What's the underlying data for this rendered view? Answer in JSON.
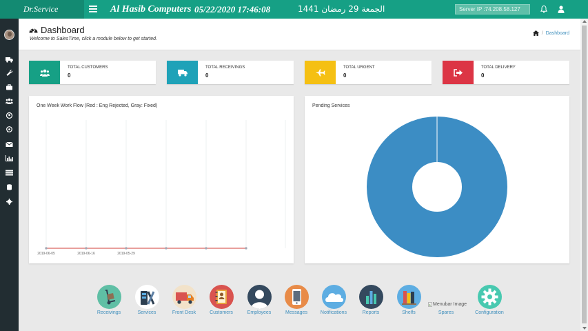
{
  "topbar": {
    "brand": "Dr.Service",
    "company": "Al Hasib Computers",
    "datetime": "05/22/2020 17:46:08",
    "hijri": "الجمعة 29 رمضان 1441",
    "server": "Server IP :74.208.58.127",
    "color": "#16a085"
  },
  "sidebar": {
    "icons": [
      "truck-icon",
      "wrench-icon",
      "briefcase-icon",
      "users-icon",
      "user-circle-icon",
      "whatsapp-icon",
      "envelope-icon",
      "bar-chart-icon",
      "list-icon",
      "database-icon",
      "gear-icon"
    ]
  },
  "header": {
    "title": "Dashboard",
    "subtitle": "Welcome to SalesTime, click a module below to get started.",
    "breadcrumb": "Dashboard"
  },
  "info_boxes": [
    {
      "label": "TOTAL CUSTOMERS",
      "value": "0",
      "color": "#16a085",
      "icon": "users-icon"
    },
    {
      "label": "TOTAL RECEIVINGS",
      "value": "0",
      "color": "#1fa2b8",
      "icon": "truck-icon"
    },
    {
      "label": "TOTAL URGENT",
      "value": "0",
      "color": "#f5c013",
      "icon": "plane-icon"
    },
    {
      "label": "TOTAL DELIVERY",
      "value": "0",
      "color": "#dc3545",
      "icon": "sign-out-icon"
    }
  ],
  "workflow_panel": {
    "title": "One Week Work Flow (Red : Eng Rejected, Gray: Fixed)"
  },
  "pending_panel": {
    "title": "Pending Services"
  },
  "chart_data": [
    {
      "type": "line",
      "title": "One Week Work Flow (Red : Eng Rejected, Gray: Fixed)",
      "x_tick_labels": [
        "2019-06-05",
        "2019-06-16",
        "2019-05-29"
      ],
      "series": [
        {
          "name": "Eng Rejected",
          "color": "#e8736b",
          "values": [
            0,
            0,
            0,
            0,
            0,
            0
          ]
        },
        {
          "name": "Fixed",
          "color": "#a0a8b4",
          "values": [
            0,
            0,
            0,
            0,
            0,
            0
          ]
        }
      ],
      "grid": true
    },
    {
      "type": "pie",
      "subtype": "doughnut",
      "title": "Pending Services",
      "values": [
        100
      ],
      "colors": [
        "#3c8dc4"
      ]
    }
  ],
  "modules": [
    {
      "label": "Receivings",
      "icon": "hand-truck-icon",
      "color": "#5fbfa5"
    },
    {
      "label": "Services",
      "icon": "tools-icon",
      "color": "#ffffff"
    },
    {
      "label": "Front Desk",
      "icon": "delivery-truck-icon",
      "color": "#f2e2c9"
    },
    {
      "label": "Customers",
      "icon": "address-book-icon",
      "color": "#d9534f"
    },
    {
      "label": "Employees",
      "icon": "employee-icon",
      "color": "#34495e"
    },
    {
      "label": "Messages",
      "icon": "phone-icon",
      "color": "#e88b48"
    },
    {
      "label": "Notifications",
      "icon": "cloud-icon",
      "color": "#5dade2"
    },
    {
      "label": "Reports",
      "icon": "report-chart-icon",
      "color": "#34495e"
    },
    {
      "label": "Shelfs",
      "icon": "books-icon",
      "color": "#5dade2"
    },
    {
      "label": "Spares",
      "icon": "broken-image-icon",
      "alt": "Menubar Image",
      "color": "#ffffff"
    },
    {
      "label": "Configuration",
      "icon": "gear-icon",
      "color": "#48c9b0"
    }
  ]
}
